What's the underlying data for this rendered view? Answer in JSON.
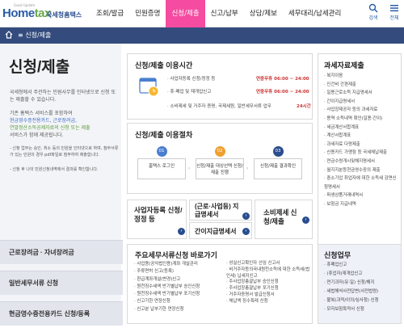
{
  "header": {
    "logo_small": "Good Update",
    "logo_main": "Hometax",
    "logo_sub": "국세청홈택스",
    "menu": [
      "조회/발급",
      "민원증명",
      "신청/제출",
      "신고/납부",
      "상담/제보",
      "세무대리/납세관리"
    ],
    "active_index": 2,
    "tools": [
      {
        "label": "검색",
        "icon": "search-icon"
      },
      {
        "label": "전체",
        "icon": "menu-icon"
      }
    ]
  },
  "location": {
    "text": "신청/제출",
    "icon": "home-icon"
  },
  "left": {
    "title": "신청/제출",
    "intro1": "국세청에서 주관하는 민원사무를 인터넷으로 신청 또는 제출할 수 있습니다.",
    "intro2a": "기존 홈택스 서비스를 포함하여",
    "intro2b": "현금영수증전용카드, 근로장려금,",
    "intro2c": "연말정산소득공제자료의 신청 또는 제출",
    "intro2d": "서비스가 함께 제공됩니다.",
    "bullet1": "- 신청 업무는 승인, 취소 등의 민원을 인터넷으로 하며, 첨부서류가 있는 민원의 경우 pdf파일로 첨부하여 제출합니다.",
    "bullet2": "- 신청 후 나의 민원신청내역에서 결과를 확인합니다.",
    "nav": [
      "근로장려금 · 자녀장려금",
      "일반세무서류 신청",
      "현금영수증전용카드 신청/등록"
    ]
  },
  "hours": {
    "title": "신청/제출 이용시간",
    "rows": [
      {
        "label": "· 사업자등록 신청/정정 등",
        "time": "연중무휴 06:00 ~ 24:00"
      },
      {
        "label": "· 휴·폐업 및 재개업신고",
        "time": "연중무휴 06:00 ~ 24:00"
      },
      {
        "label": "· 소비제세 및 거주자 증명, 국제세원, 일반세무서류 업무",
        "time": "24시간"
      }
    ]
  },
  "procedure": {
    "title": "신청/제출 이용절차",
    "steps": [
      {
        "num": "01",
        "label": "홈택스 로그인",
        "color": "#4a7fd0"
      },
      {
        "num": "02",
        "label": "신청/제출 대상선택 신청/제출 진행",
        "color": "#f0a030"
      },
      {
        "num": "03",
        "label": "신청/제출 결과확인",
        "color": "#2a4d8f"
      }
    ]
  },
  "shortcuts": {
    "s1": "사업자등록 신청/정정 등",
    "s2": "(근로·사업등) 지급명세서",
    "s3": "간이지급명세서",
    "s4": "소비제세 신청/제출"
  },
  "quick": {
    "title": "주요세무서류신청 바로가기",
    "col1": [
      "· 사업용(공익법인용)계좌 개설관리",
      "· 주류면허 신고(등록)",
      "· 환급계좌개설(변경)신고",
      "· 원천징수세액 반기별납부 승인신청",
      "· 원천징수세액 반기별납부 포기신청",
      "· 신고기한 연장신청",
      "· 신고분 납부기한 연장신청"
    ],
    "col2": [
      "· 성실신고확인자 선임 신고서",
      "· 비거주자등의국내원천소득에 대한 소득세(법인세) 납세지신고",
      "· 주사업장총괄납부 승인신청",
      "· 주사업장총괄납부 포기신청",
      "· 거주자증명서 발급신청서",
      "· 체납액 징수특례 신청"
    ]
  },
  "docs": {
    "title": "과세자료제출",
    "items": [
      "· 복지이음",
      "· 인건비 간편제출",
      "· 일용근로소득 지급명세서",
      "· 간이지급명세서",
      "· 사업장제공자 등의 과세자료",
      "· 용역 소득내역 확인(일용·간이)",
      "· 세금계산서합계표",
      "· 계산서합계표",
      "· 과세자료 다량제출",
      "· 신용카드 가맹점 등 국세체납제출",
      "· 연금수령개시및해지명세서",
      "· 월지지분등현금영수증의 제출",
      "· 중소기업 취업자에 대한 소득세 감면신청명세서",
      "· 파생상품거래내역서",
      "· 보험금 지급내역"
    ]
  },
  "apply": {
    "title": "신청업무",
    "items": [
      "· 휴폐업신고",
      "· (휴업자)재개업신고",
      "· 연기과자(유·일) 신청/해지",
      "· 세법해석사전답변(사전법령)",
      "· 불복(과적/이의/심사청) 신청",
      "· 모자보험특약서 신청"
    ]
  }
}
